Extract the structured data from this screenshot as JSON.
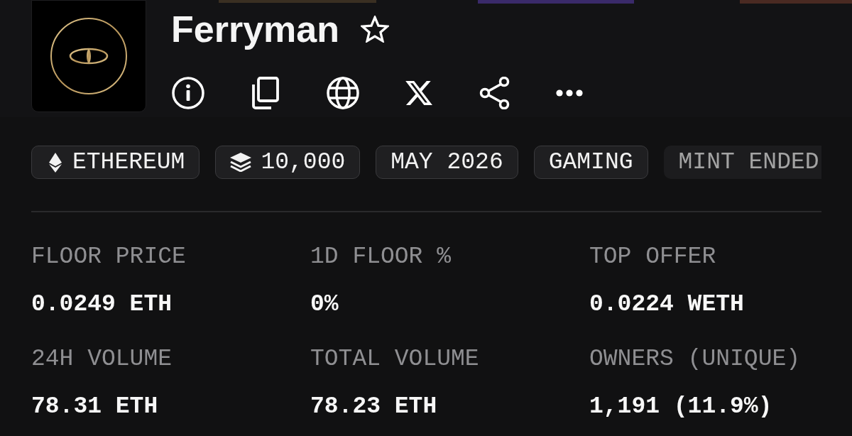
{
  "collection": {
    "name": "Ferryman",
    "favorited": false
  },
  "tags": [
    {
      "kind": "chain",
      "label": "ETHEREUM"
    },
    {
      "kind": "supply",
      "label": "10,000"
    },
    {
      "kind": "plain",
      "label": "MAY 2026"
    },
    {
      "kind": "plain",
      "label": "GAMING"
    },
    {
      "kind": "status",
      "label": "MINT ENDED"
    }
  ],
  "stats": [
    {
      "label": "FLOOR PRICE",
      "value": "0.0249 ETH"
    },
    {
      "label": "1D FLOOR %",
      "value": "0%"
    },
    {
      "label": "TOP OFFER",
      "value": "0.0224 WETH"
    },
    {
      "label": "24H VOLUME",
      "value": "78.31 ETH"
    },
    {
      "label": "TOTAL VOLUME",
      "value": "78.23 ETH"
    },
    {
      "label": "OWNERS (UNIQUE)",
      "value": "1,191 (11.9%)"
    }
  ]
}
